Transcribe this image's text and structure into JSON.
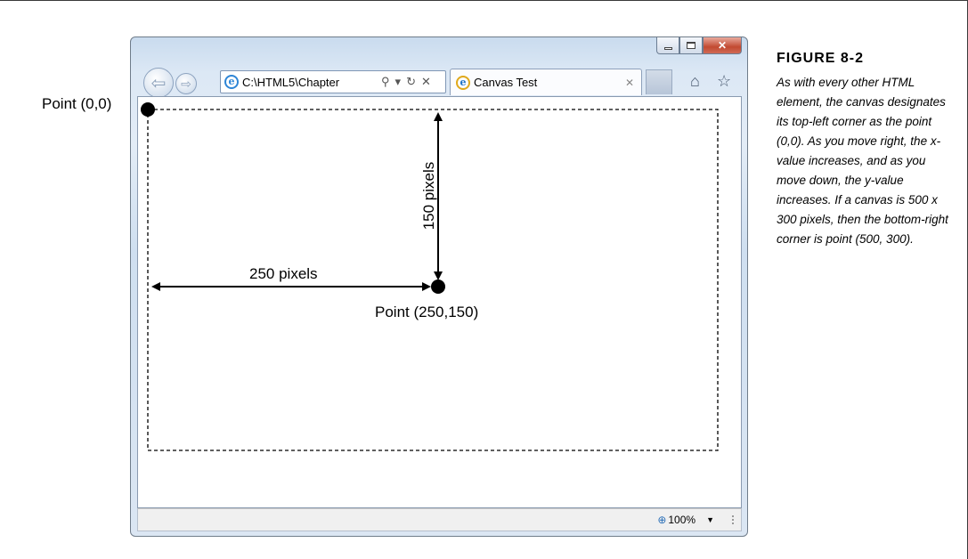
{
  "browser": {
    "address_text": "C:\\HTML5\\Chapter",
    "tab_title": "Canvas Test",
    "zoom_text": "100%",
    "icons": [
      "back-arrow-icon",
      "forward-arrow-icon",
      "ie-logo-icon",
      "search-icon",
      "refresh-icon",
      "stop-icon",
      "home-icon",
      "favorites-star-icon",
      "minimize-icon",
      "maximize-icon",
      "close-icon",
      "zoom-icon"
    ]
  },
  "diagram": {
    "origin_label": "Point (0,0)",
    "point_label": "Point (250,150)",
    "horizontal_label": "250 pixels",
    "vertical_label": "150 pixels"
  },
  "figure": {
    "title": "FIGURE 8-2",
    "caption": "As with every other HTML element, the canvas designates its top-left corner as the point (0,0). As you move right, the x-value increases, and as you move down, the y-value increases. If a canvas is 500 x 300 pixels, then the bottom-right corner is point (500, 300)."
  }
}
